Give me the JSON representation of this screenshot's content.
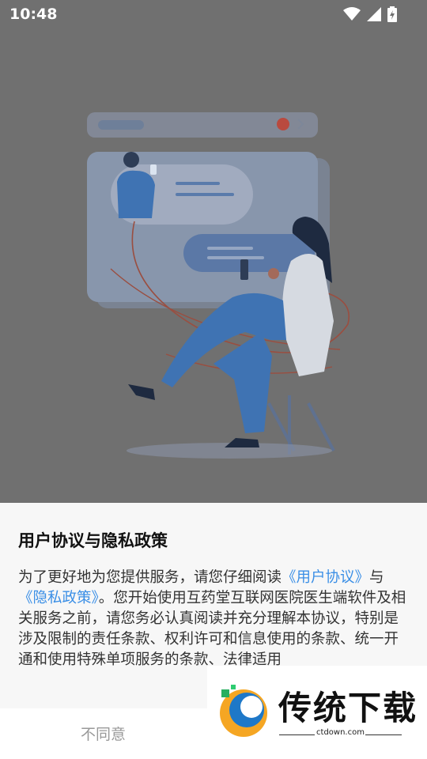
{
  "status_bar": {
    "time": "10:48"
  },
  "dialog": {
    "title": "用户协议与隐私政策",
    "body": {
      "part1": "为了更好地为您提供服务，请您仔细阅读",
      "user_agreement_link": "《用户协议》",
      "and": "与",
      "privacy_link": "《隐私政策》",
      "part2": "。您开始使用互药堂互联网医院医生端软件及相关服务之前，请您务必认真阅读并充分理解本协议，特别是涉及限制的责任条款、权利许可和信息使用的条款、统一开通和使用特殊单项服务的条款、法律适用"
    },
    "disagree_label": "不同意"
  },
  "watermark": {
    "brand": "传统下载",
    "url": "ctdown.com"
  },
  "colors": {
    "overlay": "#707070",
    "link": "#3b8fe6",
    "illustration_blue": "#3f73b3"
  }
}
